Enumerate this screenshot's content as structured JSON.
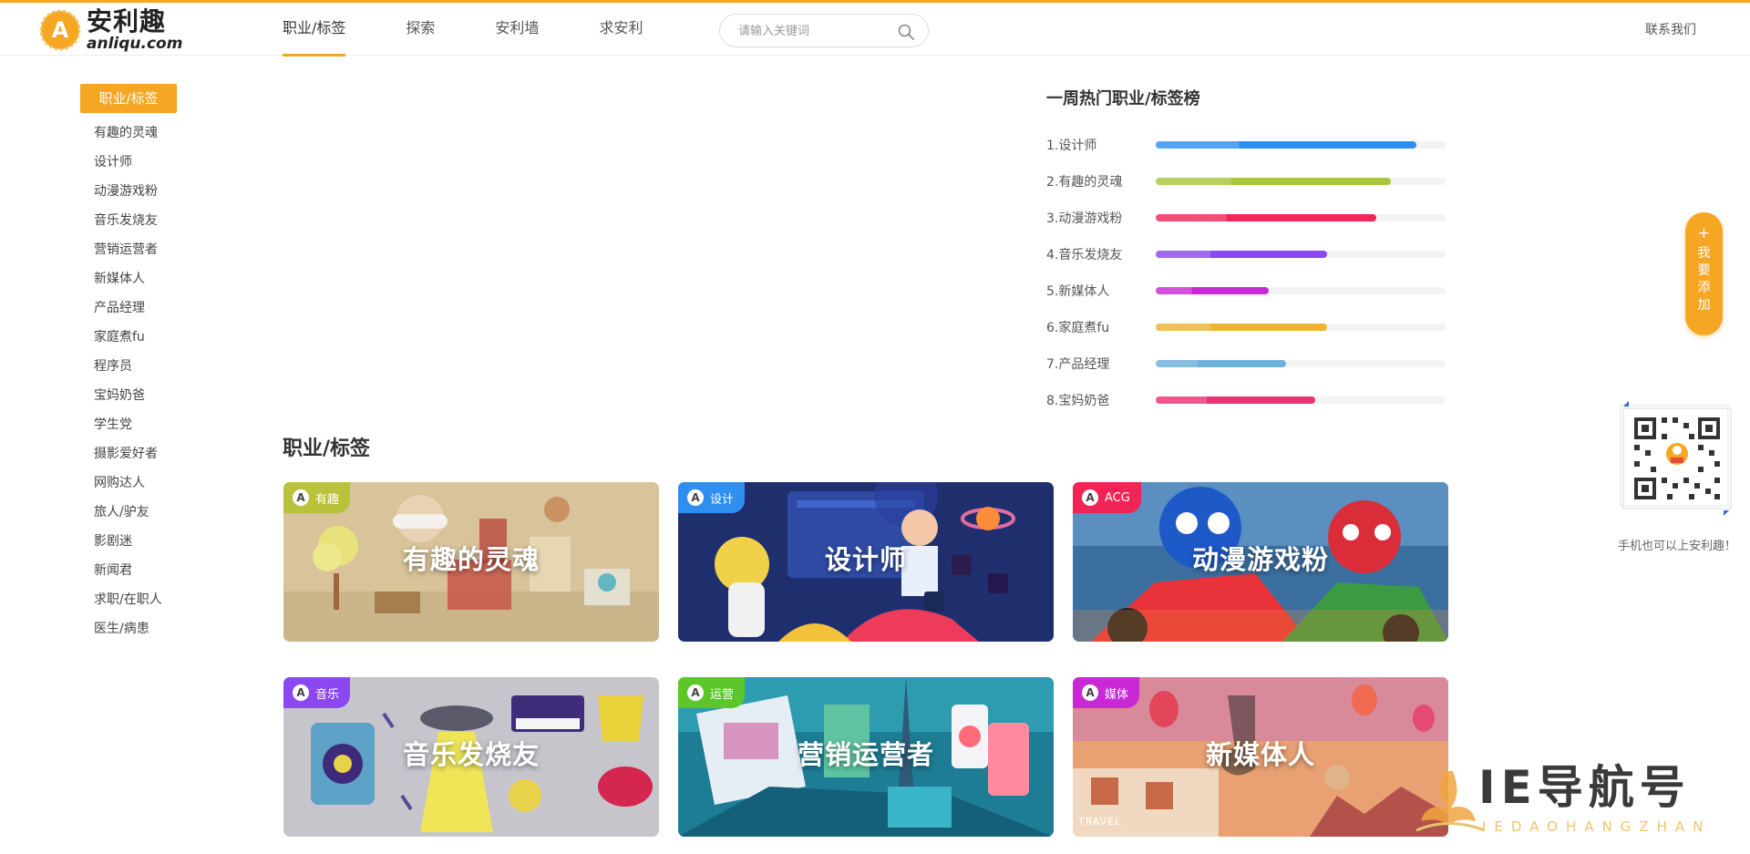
{
  "header": {
    "logo_cn": "安利趣",
    "logo_en": "anliqu.com",
    "nav": [
      "职业/标签",
      "探索",
      "安利墙",
      "求安利"
    ],
    "search_placeholder": "请输入关键词",
    "contact": "联系我们"
  },
  "sidebar": {
    "title": "职业/标签",
    "items": [
      "有趣的灵魂",
      "设计师",
      "动漫游戏粉",
      "音乐发烧友",
      "营销运营者",
      "新媒体人",
      "产品经理",
      "家庭煮fu",
      "程序员",
      "宝妈奶爸",
      "学生党",
      "摄影爱好者",
      "网购达人",
      "旅人/驴友",
      "影剧迷",
      "新闻君",
      "求职/在职人",
      "医生/病患"
    ]
  },
  "ranking": {
    "title": "一周热门职业/标签榜",
    "rows": [
      {
        "label": "1.设计师",
        "value": 0.9,
        "color": "#2f8ff0"
      },
      {
        "label": "2.有趣的灵魂",
        "value": 0.81,
        "color": "#a8c738"
      },
      {
        "label": "3.动漫游戏粉",
        "value": 0.76,
        "color": "#f5245a"
      },
      {
        "label": "4.音乐发烧友",
        "value": 0.59,
        "color": "#8c48f0"
      },
      {
        "label": "5.新媒体人",
        "value": 0.39,
        "color": "#c929d5"
      },
      {
        "label": "6.家庭煮fu",
        "value": 0.59,
        "color": "#f0b430"
      },
      {
        "label": "7.产品经理",
        "value": 0.45,
        "color": "#6cb2dc"
      },
      {
        "label": "8.宝妈奶爸",
        "value": 0.55,
        "color": "#ee3175"
      }
    ]
  },
  "section": {
    "title": "职业/标签",
    "cards": [
      {
        "tag": "有趣",
        "title": "有趣的灵魂",
        "tag_color": "#b8c23a"
      },
      {
        "tag": "设计",
        "title": "设计师",
        "tag_color": "#2f8ff0"
      },
      {
        "tag": "ACG",
        "title": "动漫游戏粉",
        "tag_color": "#f02455"
      },
      {
        "tag": "音乐",
        "title": "音乐发烧友",
        "tag_color": "#8c48f0"
      },
      {
        "tag": "运营",
        "title": "营销运营者",
        "tag_color": "#5cc62a"
      },
      {
        "tag": "媒体",
        "title": "新媒体人",
        "tag_color": "#c929d5"
      }
    ],
    "travel_text": "TRAVEL"
  },
  "float": {
    "plus": "+",
    "label": "我要添加"
  },
  "qr": {
    "caption": "手机也可以上安利趣！"
  },
  "watermark": {
    "title": "IE导航号",
    "subtitle": "IEDAOHANGZHAN"
  },
  "colors": {
    "accent": "#f5a623"
  }
}
